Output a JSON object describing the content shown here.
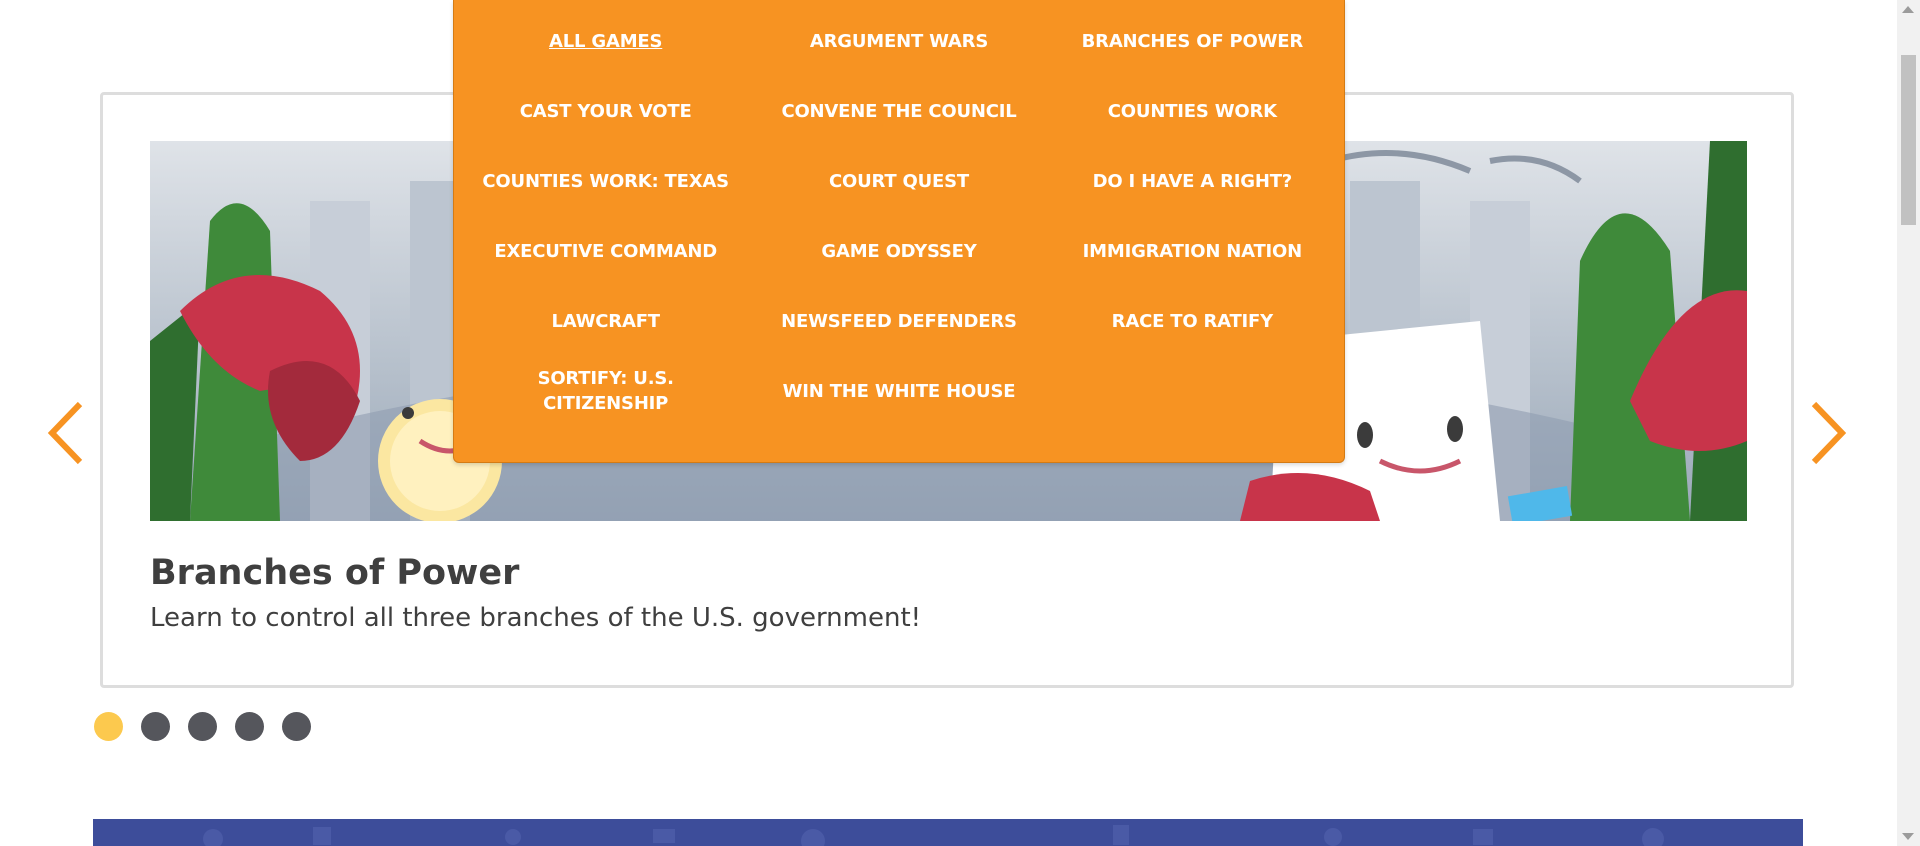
{
  "menu": {
    "items": [
      {
        "label": "ALL GAMES"
      },
      {
        "label": "ARGUMENT WARS"
      },
      {
        "label": "BRANCHES OF POWER"
      },
      {
        "label": "CAST YOUR VOTE"
      },
      {
        "label": "CONVENE THE COUNCIL"
      },
      {
        "label": "COUNTIES WORK"
      },
      {
        "label": "COUNTIES WORK: TEXAS"
      },
      {
        "label": "COURT QUEST"
      },
      {
        "label": "DO I HAVE A RIGHT?"
      },
      {
        "label": "EXECUTIVE COMMAND"
      },
      {
        "label": "GAME ODYSSEY"
      },
      {
        "label": "IMMIGRATION NATION"
      },
      {
        "label": "LAWCRAFT"
      },
      {
        "label": "NEWSFEED DEFENDERS"
      },
      {
        "label": "RACE TO RATIFY"
      },
      {
        "label": "SORTIFY: U.S. CITIZENSHIP"
      },
      {
        "label": "WIN THE WHITE HOUSE"
      }
    ],
    "current_index": 0
  },
  "carousel": {
    "slide": {
      "title": "Branches of Power",
      "description": "Learn to control all three branches of the U.S. government!"
    },
    "slide_count": 5,
    "active_index": 0
  },
  "colors": {
    "menu_background": "#f79322",
    "arrow": "#f79322",
    "dot_active": "#fcc94e",
    "dot_inactive": "#55565c",
    "band": "#3d4d9a"
  },
  "icons": {
    "prev": "chevron-left-icon",
    "next": "chevron-right-icon"
  }
}
